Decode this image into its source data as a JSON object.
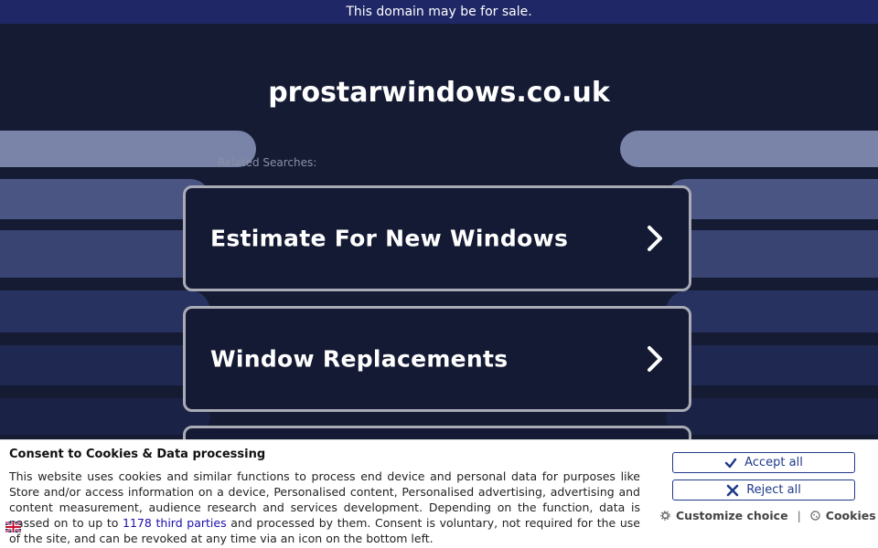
{
  "banner": {
    "text": "This domain may be for sale."
  },
  "domain": {
    "name": "prostarwindows.co.uk"
  },
  "related": {
    "label": "Related Searches:"
  },
  "links": [
    {
      "label": "Estimate For New Windows"
    },
    {
      "label": "Window Replacements"
    }
  ],
  "consent": {
    "title": "Consent to Cookies & Data processing",
    "text_before": "This website uses cookies and similar functions to process end device and personal data for purposes like Store and/or access information on a device, Personalised content, Personalised advertising, advertising and content measurement, audience research and services development. Depending on the function, data is passed on to up to ",
    "link": "1178 third parties",
    "text_after": " and processed by them. Consent is voluntary, not required for the use of the site, and can be revoked at any time via an icon on the bottom left.",
    "accept_label": "Accept all",
    "reject_label": "Reject all",
    "customize_label": "Customize choice",
    "separator": "|",
    "cookies_label": "Cookies"
  },
  "colors": {
    "background": "#151b33",
    "banner": "#1f2766",
    "accent": "#1e3a8a"
  }
}
